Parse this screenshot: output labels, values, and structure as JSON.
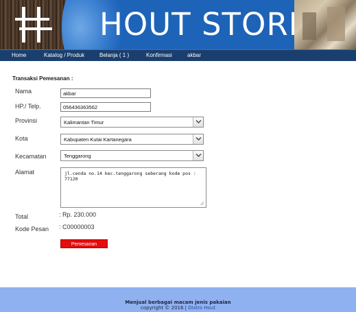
{
  "banner": {
    "title": "HOUT STORE",
    "logo_letters": "HH"
  },
  "nav": {
    "items": [
      {
        "label": "Home"
      },
      {
        "label": "Katalog / Produk"
      },
      {
        "label": "Belanja  ( 1 )"
      },
      {
        "label": "Konfirmasi"
      },
      {
        "label": "akbar"
      }
    ]
  },
  "form": {
    "title": "Transaksi Pemesanan :",
    "nama": {
      "label": "Nama",
      "value": "akbar"
    },
    "telp": {
      "label": "HP./ Telp.",
      "value": "056436363562"
    },
    "provinsi": {
      "label": "Provinsi",
      "value": "Kalimantan Timur"
    },
    "kota": {
      "label": "Kota",
      "value": "Kabupaten Kutai Kartanegara"
    },
    "kecamatan": {
      "label": "Kecamatan",
      "value": "Tenggarong"
    },
    "alamat": {
      "label": "Alamat",
      "value": "jl.cenda no.14 kec.tenggarong seberang kode pos : 77120"
    },
    "total": {
      "label": "Total",
      "value": ": Rp. 230.000"
    },
    "kode": {
      "label": "Kode Pesan",
      "value": ": C00000003"
    },
    "submit_label": "Pemesanan"
  },
  "footer": {
    "tagline": "Menjual berbagai macam jenis pakaian",
    "copyright_prefix": "copyright © 2016 |",
    "brand": "Distro Hout"
  },
  "colors": {
    "banner": "#1d63b8",
    "nav": "#1a3f6e",
    "button": "#e30d0d",
    "footer": "#8fb1ef"
  }
}
